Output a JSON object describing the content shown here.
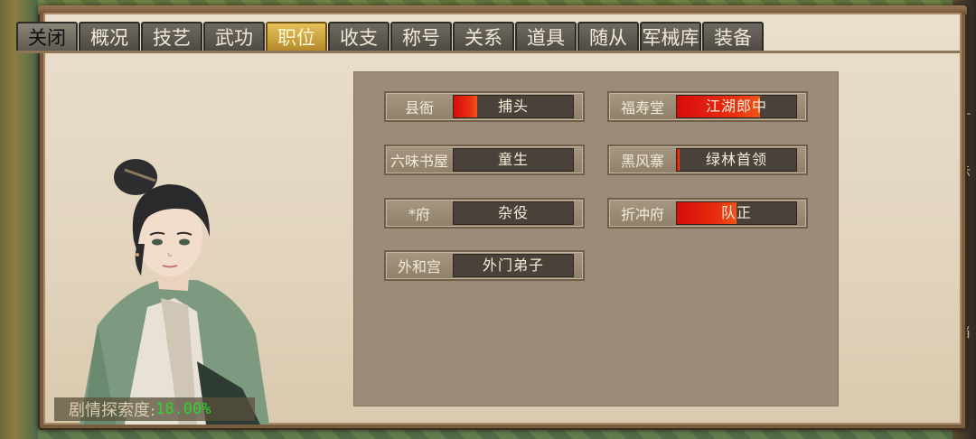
{
  "tabs": [
    {
      "label": "关闭",
      "kind": "close"
    },
    {
      "label": "概况"
    },
    {
      "label": "技艺"
    },
    {
      "label": "武功"
    },
    {
      "label": "职位",
      "active": true
    },
    {
      "label": "收支"
    },
    {
      "label": "称号"
    },
    {
      "label": "关系"
    },
    {
      "label": "道具"
    },
    {
      "label": "随从"
    },
    {
      "label": "军械库"
    },
    {
      "label": "装备"
    }
  ],
  "story_progress": {
    "label": "剧情探索度:",
    "value": "18.00%"
  },
  "positions": [
    {
      "org": "县衙",
      "rank": "捕头",
      "progress": 0.2
    },
    {
      "org": "福寿堂",
      "rank": "江湖郎中",
      "progress": 0.7
    },
    {
      "org": "六味书屋",
      "rank": "童生",
      "progress": 0
    },
    {
      "org": "黑风寨",
      "rank": "绿林首领",
      "progress": 0.02
    },
    {
      "org": "*府",
      "rank": "杂役",
      "progress": 0
    },
    {
      "org": "折冲府",
      "rank": "队正",
      "progress": 0.5
    },
    {
      "org": "外和宫",
      "rank": "外门弟子",
      "progress": 0
    }
  ],
  "side_glyphs": [
    "计",
    "示",
    "当"
  ],
  "colors": {
    "active_tab": "#e6c15a",
    "progress_text": "#2fd42f",
    "fill": "#d80c0c"
  }
}
